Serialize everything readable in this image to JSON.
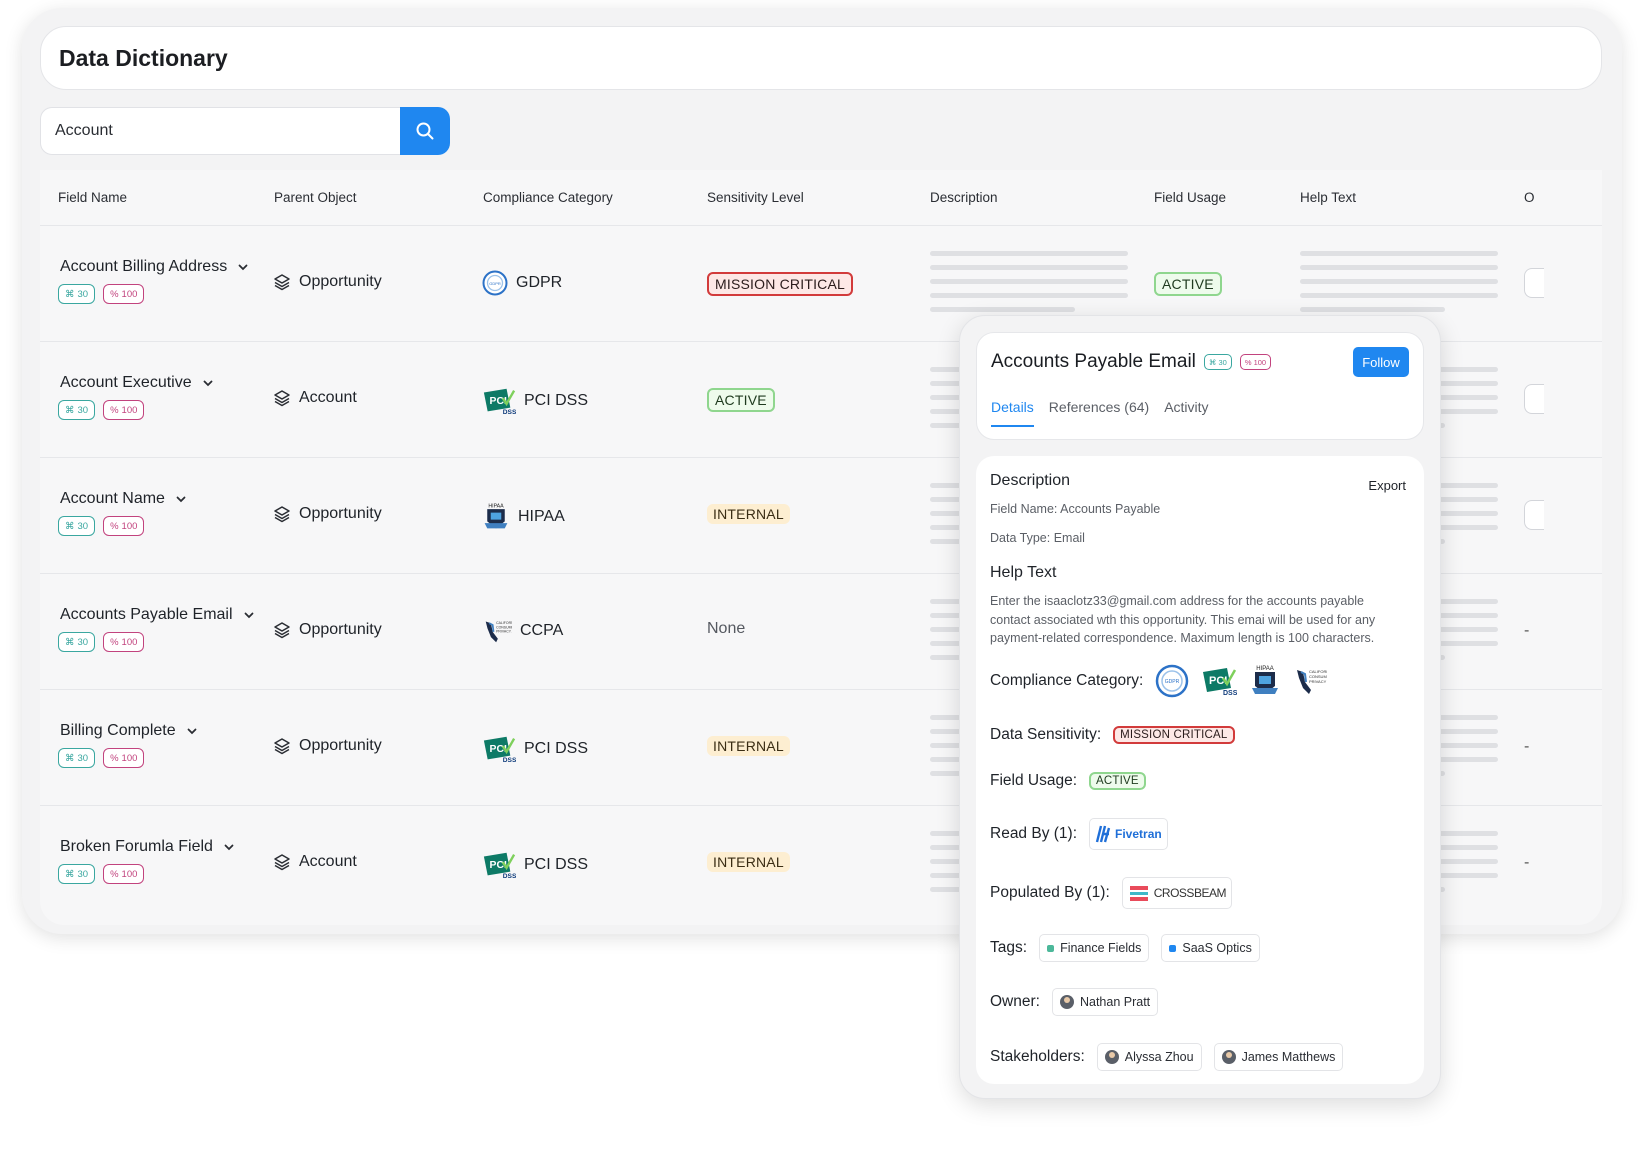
{
  "app": {
    "title": "Data Dictionary"
  },
  "search": {
    "value": "Account"
  },
  "table": {
    "columns": [
      "Field Name",
      "Parent Object",
      "Compliance Category",
      "Sensitivity Level",
      "Description",
      "Field Usage",
      "Help Text",
      "O"
    ],
    "rows": [
      {
        "field": "Account Billing Address",
        "badge_a": "30",
        "badge_b": "100",
        "parent": "Opportunity",
        "compliance": "GDPR",
        "sensitivity": "MISSION CRITICAL",
        "sensitivity_style": "red",
        "usage": "ACTIVE"
      },
      {
        "field": "Account Executive",
        "badge_a": "30",
        "badge_b": "100",
        "parent": "Account",
        "compliance": "PCI DSS",
        "sensitivity": "ACTIVE",
        "sensitivity_style": "green",
        "usage": ""
      },
      {
        "field": "Account Name",
        "badge_a": "30",
        "badge_b": "100",
        "parent": "Opportunity",
        "compliance": "HIPAA",
        "sensitivity": "INTERNAL",
        "sensitivity_style": "amber",
        "usage": ""
      },
      {
        "field": "Accounts Payable Email",
        "badge_a": "30",
        "badge_b": "100",
        "parent": "Opportunity",
        "compliance": "CCPA",
        "sensitivity": "None",
        "sensitivity_style": "none",
        "usage": ""
      },
      {
        "field": "Billing Complete",
        "badge_a": "30",
        "badge_b": "100",
        "parent": "Opportunity",
        "compliance": "PCI DSS",
        "sensitivity": "INTERNAL",
        "sensitivity_style": "amber",
        "usage": ""
      },
      {
        "field": "Broken Forumla Field",
        "badge_a": "30",
        "badge_b": "100",
        "parent": "Account",
        "compliance": "PCI DSS",
        "sensitivity": "INTERNAL",
        "sensitivity_style": "amber",
        "usage": ""
      }
    ],
    "edge_dash": "-"
  },
  "panel": {
    "title": "Accounts Payable Email",
    "badge_a": "30",
    "badge_b": "100",
    "follow": "Follow",
    "tabs": [
      "Details",
      "References (64)",
      "Activity"
    ],
    "description_heading": "Description",
    "export": "Export",
    "field_name_line": "Field Name: Accounts Payable",
    "data_type_line": "Data Type: Email",
    "help_heading": "Help Text",
    "help_text": "Enter the isaaclotz33@gmail.com address for the accounts payable contact associated wth this opportunity. This emai will be used for any payment-related correspondence. Maximum length is 100 characters.",
    "compliance_label": "Compliance Category:",
    "sensitivity_label": "Data Sensitivity:",
    "sensitivity_value": "MISSION CRITICAL",
    "usage_label": "Field Usage:",
    "usage_value": "ACTIVE",
    "read_by_label": "Read By (1):",
    "read_by_value": "Fivetran",
    "populated_by_label": "Populated By (1):",
    "populated_by_value": "CROSSBEAM",
    "tags_label": "Tags:",
    "tags": [
      {
        "label": "Finance Fields",
        "color": "#4cb89a"
      },
      {
        "label": "SaaS Optics",
        "color": "#1f87f0"
      }
    ],
    "owner_label": "Owner:",
    "owner": "Nathan Pratt",
    "stakeholders_label": "Stakeholders:",
    "stakeholders": [
      "Alyssa Zhou",
      "James Matthews"
    ]
  },
  "colors": {
    "accent": "#1f87f0",
    "critical": "#d23b3b",
    "active": "#8fd68e",
    "internal": "#fdeed1",
    "teal": "#3aa7a0",
    "pink": "#c2437e"
  }
}
